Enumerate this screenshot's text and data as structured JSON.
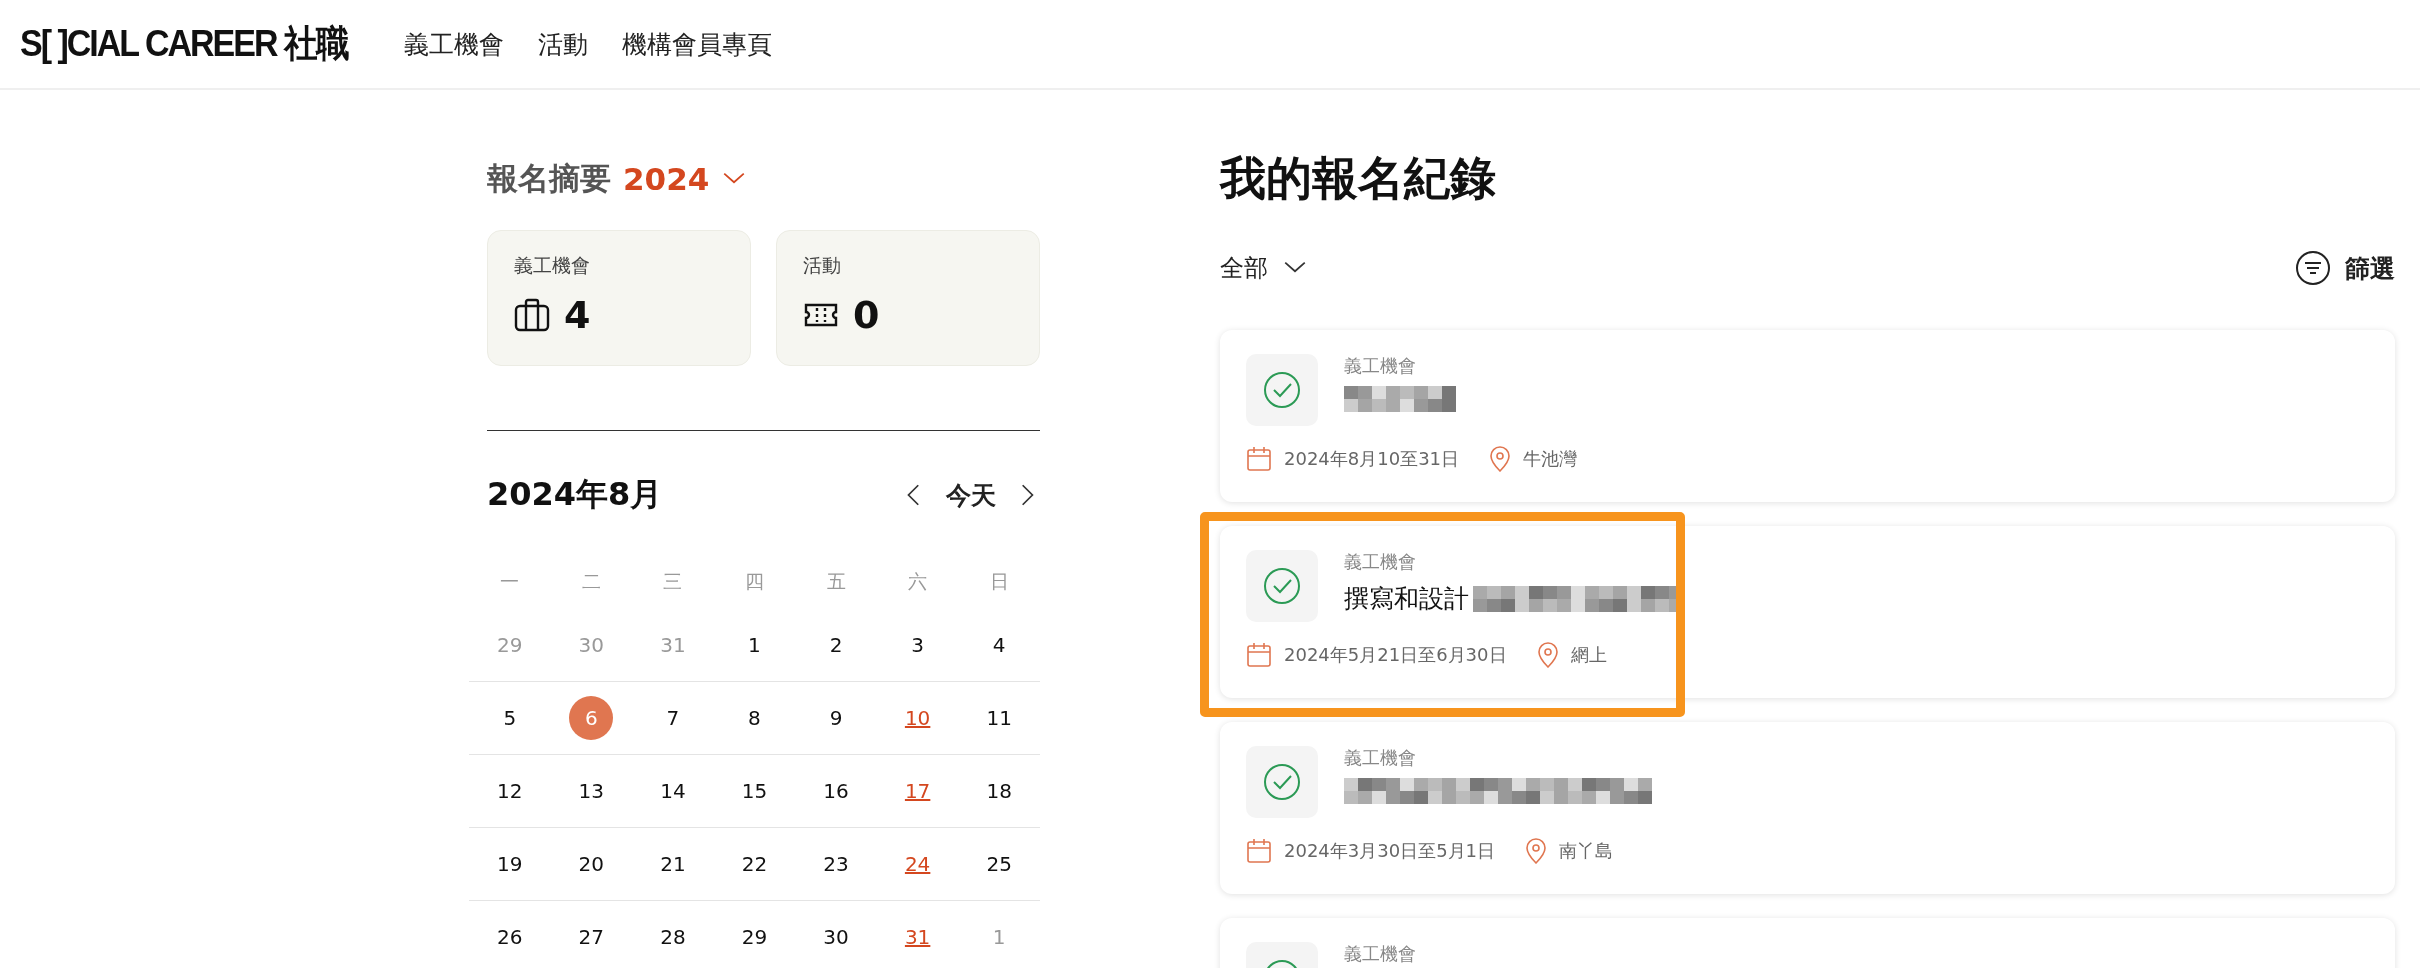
{
  "header": {
    "logo": "S[ ]CIAL CAREER 社職",
    "nav": [
      {
        "label": "義工機會"
      },
      {
        "label": "活動"
      },
      {
        "label": "機構會員專頁"
      }
    ]
  },
  "summary": {
    "title": "報名摘要",
    "year": "2024",
    "cards": [
      {
        "kind": "volunteer",
        "label": "義工機會",
        "count": "4"
      },
      {
        "kind": "event",
        "label": "活動",
        "count": "0"
      }
    ]
  },
  "calendar": {
    "title": "2024年8月",
    "today": "今天",
    "weekdays": [
      "一",
      "二",
      "三",
      "四",
      "五",
      "六",
      "日"
    ],
    "days": [
      {
        "day": "29",
        "kind": "outside",
        "selected": false
      },
      {
        "day": "30",
        "kind": "outside",
        "selected": false
      },
      {
        "day": "31",
        "kind": "outside",
        "selected": false
      },
      {
        "day": "1",
        "kind": "normal",
        "selected": false
      },
      {
        "day": "2",
        "kind": "normal",
        "selected": false
      },
      {
        "day": "3",
        "kind": "normal",
        "selected": false
      },
      {
        "day": "4",
        "kind": "normal",
        "selected": false
      },
      {
        "day": "5",
        "kind": "normal",
        "selected": false
      },
      {
        "day": "6",
        "kind": "normal",
        "selected": true
      },
      {
        "day": "7",
        "kind": "normal",
        "selected": false
      },
      {
        "day": "8",
        "kind": "normal",
        "selected": false
      },
      {
        "day": "9",
        "kind": "normal",
        "selected": false
      },
      {
        "day": "10",
        "kind": "event",
        "selected": false
      },
      {
        "day": "11",
        "kind": "normal",
        "selected": false
      },
      {
        "day": "12",
        "kind": "normal",
        "selected": false
      },
      {
        "day": "13",
        "kind": "normal",
        "selected": false
      },
      {
        "day": "14",
        "kind": "normal",
        "selected": false
      },
      {
        "day": "15",
        "kind": "normal",
        "selected": false
      },
      {
        "day": "16",
        "kind": "normal",
        "selected": false
      },
      {
        "day": "17",
        "kind": "event",
        "selected": false
      },
      {
        "day": "18",
        "kind": "normal",
        "selected": false
      },
      {
        "day": "19",
        "kind": "normal",
        "selected": false
      },
      {
        "day": "20",
        "kind": "normal",
        "selected": false
      },
      {
        "day": "21",
        "kind": "normal",
        "selected": false
      },
      {
        "day": "22",
        "kind": "normal",
        "selected": false
      },
      {
        "day": "23",
        "kind": "normal",
        "selected": false
      },
      {
        "day": "24",
        "kind": "event",
        "selected": false
      },
      {
        "day": "25",
        "kind": "normal",
        "selected": false
      },
      {
        "day": "26",
        "kind": "normal",
        "selected": false
      },
      {
        "day": "27",
        "kind": "normal",
        "selected": false
      },
      {
        "day": "28",
        "kind": "normal",
        "selected": false
      },
      {
        "day": "29",
        "kind": "normal",
        "selected": false
      },
      {
        "day": "30",
        "kind": "normal",
        "selected": false
      },
      {
        "day": "31",
        "kind": "event",
        "selected": false
      },
      {
        "day": "1",
        "kind": "outside",
        "selected": false
      }
    ]
  },
  "records": {
    "title": "我的報名紀錄",
    "filter": "全部",
    "filter_button": "篩選",
    "items": [
      {
        "type": "義工機會",
        "redacted": true,
        "date": "2024年8月10至31日",
        "location": "牛池灣",
        "highlighted": false
      },
      {
        "type": "義工機會",
        "title": "撰寫和設計",
        "redacted": true,
        "date": "2024年5月21日至6月30日",
        "location": "網上",
        "highlighted": true
      },
      {
        "type": "義工機會",
        "redacted": true,
        "date": "2024年3月30日至5月1日",
        "location": "南丫島",
        "highlighted": false
      },
      {
        "type": "義工機會",
        "highlighted": false
      }
    ]
  }
}
